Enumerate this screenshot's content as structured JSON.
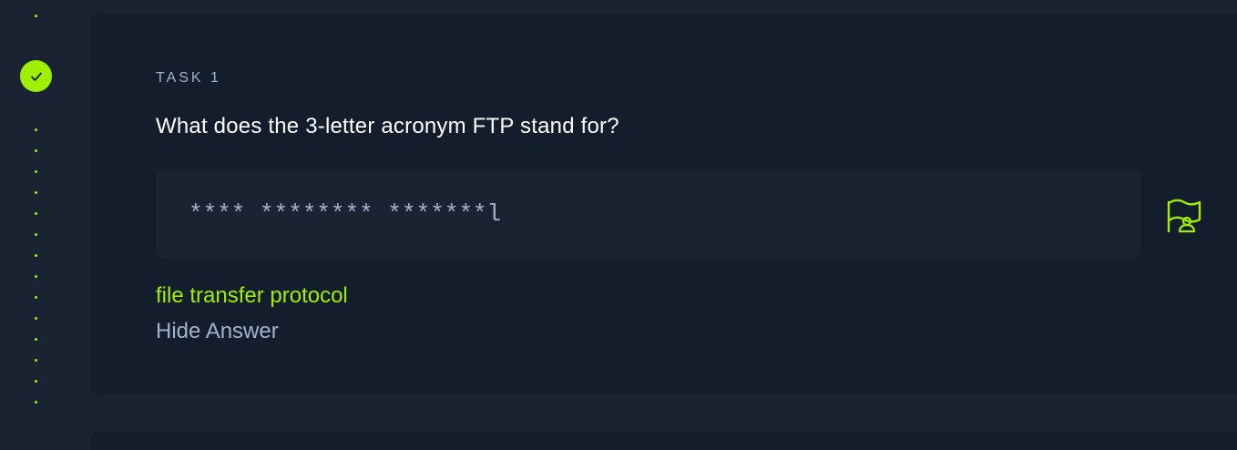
{
  "task": {
    "label": "TASK 1",
    "question": "What does the 3-letter acronym FTP stand for?",
    "answer_mask": "**** ******** *******l",
    "revealed_answer": "file transfer protocol",
    "hide_answer_label": "Hide Answer",
    "status": "completed"
  },
  "icons": {
    "status": "check-icon",
    "submit": "flag-icon"
  },
  "colors": {
    "accent": "#9fef00",
    "background": "#1a2332",
    "card": "#141d2b",
    "muted_text": "#a4b1cd",
    "text": "#ffffff"
  }
}
